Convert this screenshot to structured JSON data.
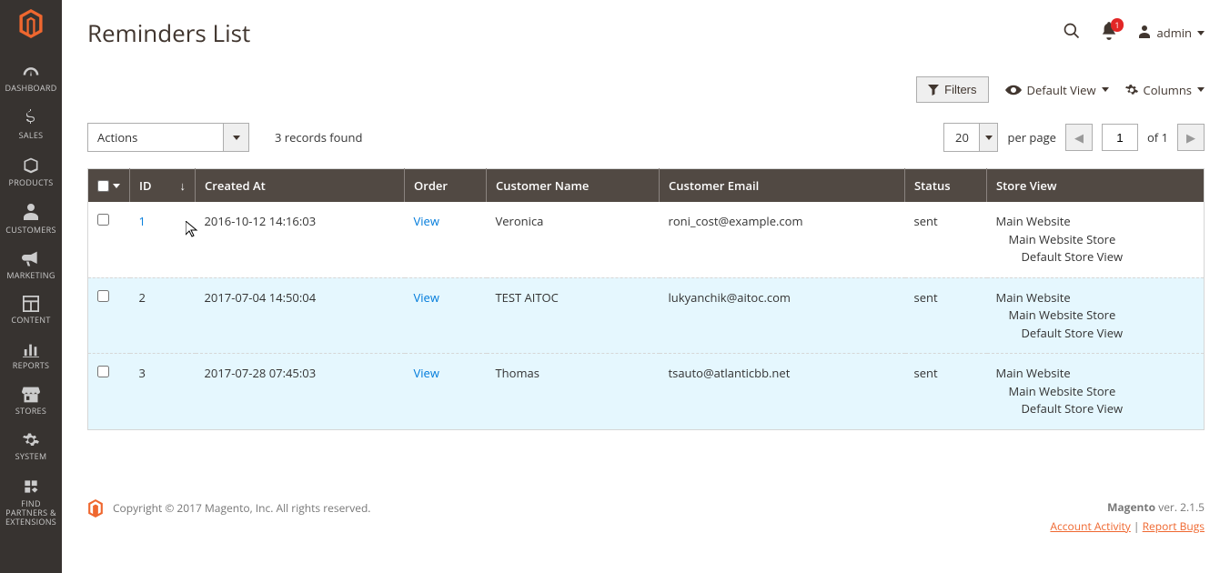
{
  "page_title": "Reminders List",
  "admin_user": "admin",
  "notification_count": "1",
  "sidenav": [
    {
      "label": "DASHBOARD"
    },
    {
      "label": "SALES"
    },
    {
      "label": "PRODUCTS"
    },
    {
      "label": "CUSTOMERS"
    },
    {
      "label": "MARKETING"
    },
    {
      "label": "CONTENT"
    },
    {
      "label": "REPORTS"
    },
    {
      "label": "STORES"
    },
    {
      "label": "SYSTEM"
    },
    {
      "label": "FIND PARTNERS & EXTENSIONS"
    }
  ],
  "toolbar": {
    "filters": "Filters",
    "default_view": "Default View",
    "columns": "Columns"
  },
  "grid": {
    "actions_label": "Actions",
    "records_found": "3 records found",
    "page_size": "20",
    "per_page_label": "per page",
    "current_page": "1",
    "of_label": "of",
    "total_pages": "1",
    "columns": {
      "id": "ID",
      "created_at": "Created At",
      "order": "Order",
      "customer_name": "Customer Name",
      "customer_email": "Customer Email",
      "status": "Status",
      "store_view": "Store View"
    },
    "view_label": "View",
    "store_view_lines": {
      "l1": "Main Website",
      "l2": "Main Website Store",
      "l3": "Default Store View"
    },
    "rows": [
      {
        "id": "1",
        "created_at": "2016-10-12 14:16:03",
        "customer_name": "Veronica",
        "customer_email": "roni_cost@example.com",
        "status": "sent"
      },
      {
        "id": "2",
        "created_at": "2017-07-04 14:50:04",
        "customer_name": "TEST AITOC",
        "customer_email": "lukyanchik@aitoc.com",
        "status": "sent"
      },
      {
        "id": "3",
        "created_at": "2017-07-28 07:45:03",
        "customer_name": "Thomas",
        "customer_email": "tsauto@atlanticbb.net",
        "status": "sent"
      }
    ]
  },
  "footer": {
    "copyright": "Copyright © 2017 Magento, Inc. All rights reserved.",
    "version_prefix": "Magento",
    "version_label": "ver. 2.1.5",
    "account_activity": "Account Activity",
    "report_bugs": "Report Bugs"
  }
}
